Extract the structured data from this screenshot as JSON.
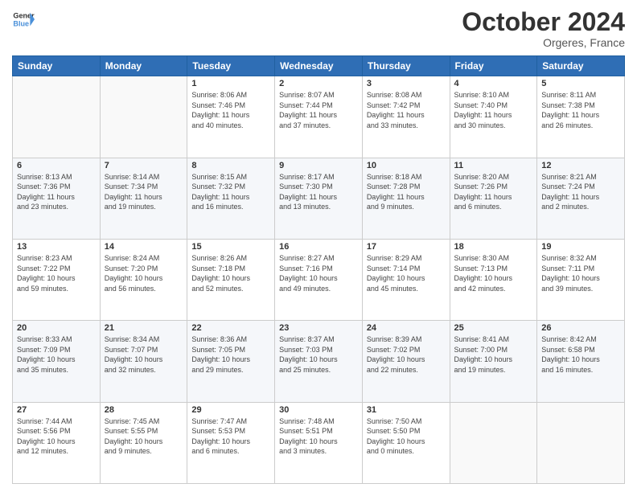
{
  "logo": {
    "line1": "General",
    "line2": "Blue"
  },
  "title": "October 2024",
  "location": "Orgeres, France",
  "header_days": [
    "Sunday",
    "Monday",
    "Tuesday",
    "Wednesday",
    "Thursday",
    "Friday",
    "Saturday"
  ],
  "weeks": [
    [
      {
        "day": "",
        "info": ""
      },
      {
        "day": "",
        "info": ""
      },
      {
        "day": "1",
        "info": "Sunrise: 8:06 AM\nSunset: 7:46 PM\nDaylight: 11 hours\nand 40 minutes."
      },
      {
        "day": "2",
        "info": "Sunrise: 8:07 AM\nSunset: 7:44 PM\nDaylight: 11 hours\nand 37 minutes."
      },
      {
        "day": "3",
        "info": "Sunrise: 8:08 AM\nSunset: 7:42 PM\nDaylight: 11 hours\nand 33 minutes."
      },
      {
        "day": "4",
        "info": "Sunrise: 8:10 AM\nSunset: 7:40 PM\nDaylight: 11 hours\nand 30 minutes."
      },
      {
        "day": "5",
        "info": "Sunrise: 8:11 AM\nSunset: 7:38 PM\nDaylight: 11 hours\nand 26 minutes."
      }
    ],
    [
      {
        "day": "6",
        "info": "Sunrise: 8:13 AM\nSunset: 7:36 PM\nDaylight: 11 hours\nand 23 minutes."
      },
      {
        "day": "7",
        "info": "Sunrise: 8:14 AM\nSunset: 7:34 PM\nDaylight: 11 hours\nand 19 minutes."
      },
      {
        "day": "8",
        "info": "Sunrise: 8:15 AM\nSunset: 7:32 PM\nDaylight: 11 hours\nand 16 minutes."
      },
      {
        "day": "9",
        "info": "Sunrise: 8:17 AM\nSunset: 7:30 PM\nDaylight: 11 hours\nand 13 minutes."
      },
      {
        "day": "10",
        "info": "Sunrise: 8:18 AM\nSunset: 7:28 PM\nDaylight: 11 hours\nand 9 minutes."
      },
      {
        "day": "11",
        "info": "Sunrise: 8:20 AM\nSunset: 7:26 PM\nDaylight: 11 hours\nand 6 minutes."
      },
      {
        "day": "12",
        "info": "Sunrise: 8:21 AM\nSunset: 7:24 PM\nDaylight: 11 hours\nand 2 minutes."
      }
    ],
    [
      {
        "day": "13",
        "info": "Sunrise: 8:23 AM\nSunset: 7:22 PM\nDaylight: 10 hours\nand 59 minutes."
      },
      {
        "day": "14",
        "info": "Sunrise: 8:24 AM\nSunset: 7:20 PM\nDaylight: 10 hours\nand 56 minutes."
      },
      {
        "day": "15",
        "info": "Sunrise: 8:26 AM\nSunset: 7:18 PM\nDaylight: 10 hours\nand 52 minutes."
      },
      {
        "day": "16",
        "info": "Sunrise: 8:27 AM\nSunset: 7:16 PM\nDaylight: 10 hours\nand 49 minutes."
      },
      {
        "day": "17",
        "info": "Sunrise: 8:29 AM\nSunset: 7:14 PM\nDaylight: 10 hours\nand 45 minutes."
      },
      {
        "day": "18",
        "info": "Sunrise: 8:30 AM\nSunset: 7:13 PM\nDaylight: 10 hours\nand 42 minutes."
      },
      {
        "day": "19",
        "info": "Sunrise: 8:32 AM\nSunset: 7:11 PM\nDaylight: 10 hours\nand 39 minutes."
      }
    ],
    [
      {
        "day": "20",
        "info": "Sunrise: 8:33 AM\nSunset: 7:09 PM\nDaylight: 10 hours\nand 35 minutes."
      },
      {
        "day": "21",
        "info": "Sunrise: 8:34 AM\nSunset: 7:07 PM\nDaylight: 10 hours\nand 32 minutes."
      },
      {
        "day": "22",
        "info": "Sunrise: 8:36 AM\nSunset: 7:05 PM\nDaylight: 10 hours\nand 29 minutes."
      },
      {
        "day": "23",
        "info": "Sunrise: 8:37 AM\nSunset: 7:03 PM\nDaylight: 10 hours\nand 25 minutes."
      },
      {
        "day": "24",
        "info": "Sunrise: 8:39 AM\nSunset: 7:02 PM\nDaylight: 10 hours\nand 22 minutes."
      },
      {
        "day": "25",
        "info": "Sunrise: 8:41 AM\nSunset: 7:00 PM\nDaylight: 10 hours\nand 19 minutes."
      },
      {
        "day": "26",
        "info": "Sunrise: 8:42 AM\nSunset: 6:58 PM\nDaylight: 10 hours\nand 16 minutes."
      }
    ],
    [
      {
        "day": "27",
        "info": "Sunrise: 7:44 AM\nSunset: 5:56 PM\nDaylight: 10 hours\nand 12 minutes."
      },
      {
        "day": "28",
        "info": "Sunrise: 7:45 AM\nSunset: 5:55 PM\nDaylight: 10 hours\nand 9 minutes."
      },
      {
        "day": "29",
        "info": "Sunrise: 7:47 AM\nSunset: 5:53 PM\nDaylight: 10 hours\nand 6 minutes."
      },
      {
        "day": "30",
        "info": "Sunrise: 7:48 AM\nSunset: 5:51 PM\nDaylight: 10 hours\nand 3 minutes."
      },
      {
        "day": "31",
        "info": "Sunrise: 7:50 AM\nSunset: 5:50 PM\nDaylight: 10 hours\nand 0 minutes."
      },
      {
        "day": "",
        "info": ""
      },
      {
        "day": "",
        "info": ""
      }
    ]
  ]
}
